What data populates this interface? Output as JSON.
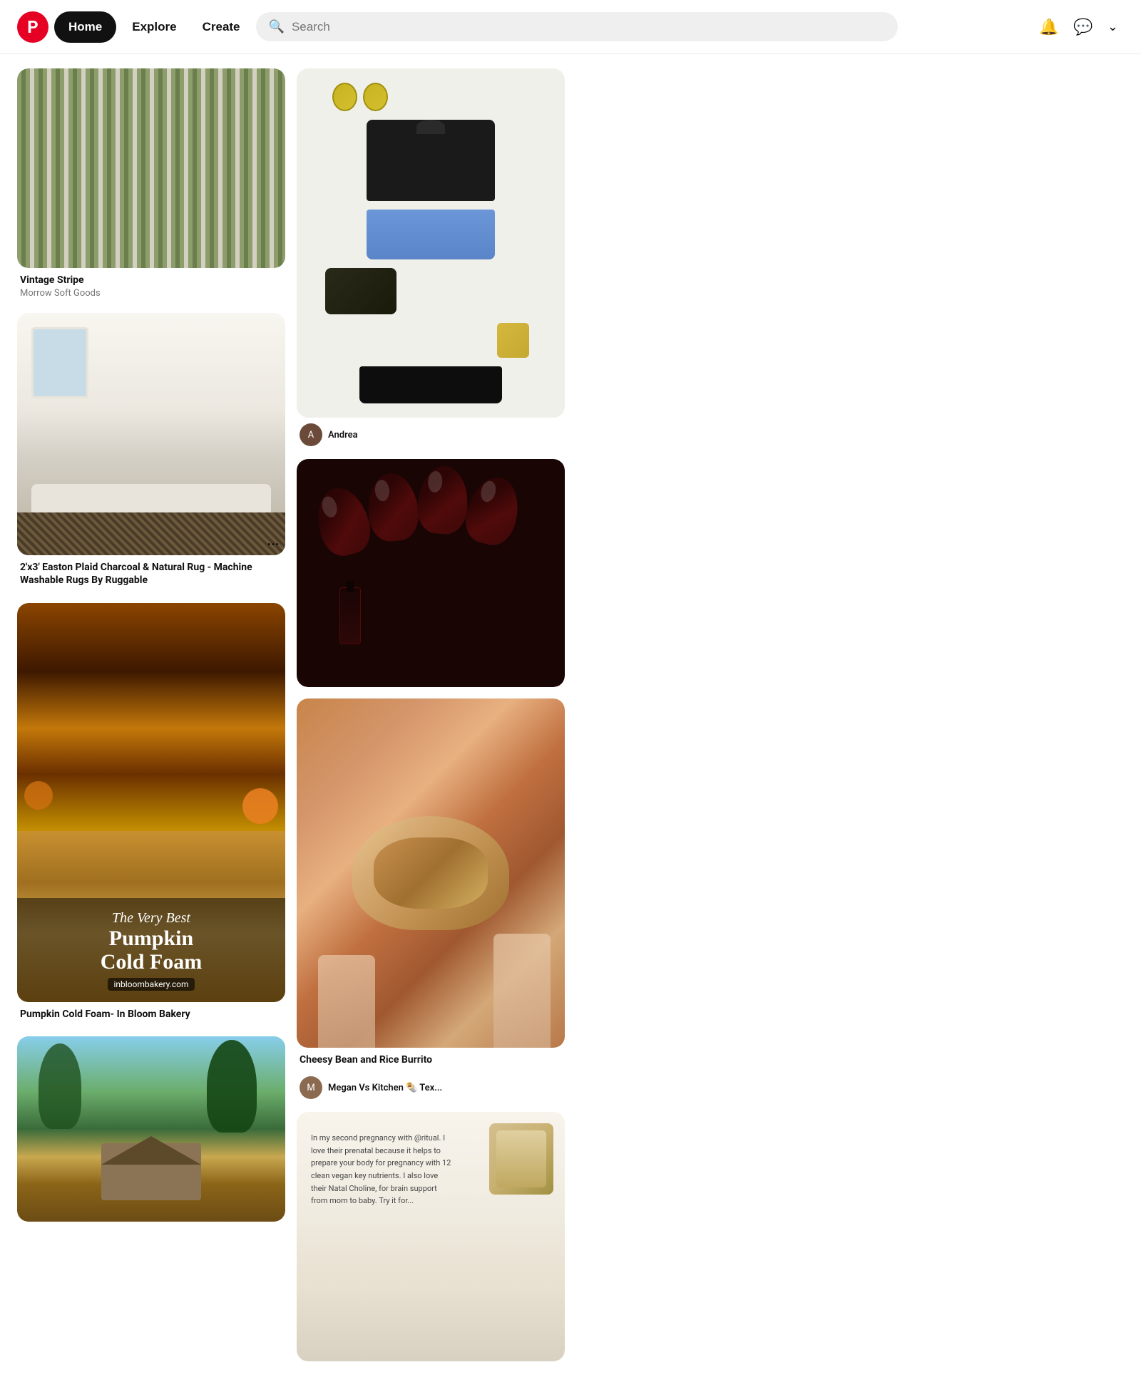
{
  "header": {
    "logo_text": "P",
    "nav_home": "Home",
    "nav_explore": "Explore",
    "nav_create": "Create",
    "search_placeholder": "Search"
  },
  "pins": [
    {
      "id": "pin-vintage-stripe",
      "type": "stripe",
      "title": "Vintage Stripe",
      "subtitle": "Morrow Soft Goods",
      "col": 0
    },
    {
      "id": "pin-pumpkin-cold-foam",
      "type": "pumpkin",
      "title": "Pumpkin Cold Foam- In Bloom Bakery",
      "subtitle": "",
      "overlay_cursive": "The Very Best",
      "overlay_bold1": "Pumpkin",
      "overlay_bold2": "Cold Foam",
      "overlay_site": "inbloombakery.com",
      "col": 1
    },
    {
      "id": "pin-andrea-fashion",
      "type": "fashion",
      "title": "",
      "subtitle": "",
      "author": "Andrea",
      "col": 2
    },
    {
      "id": "pin-burrito",
      "type": "burrito",
      "title": "Cheesy Bean and Rice Burrito",
      "subtitle": "Megan Vs Kitchen 🌯 Tex...",
      "has_author_avatar": true,
      "col": 3
    },
    {
      "id": "pin-rug",
      "type": "rug",
      "title": "2'x3' Easton Plaid Charcoal & Natural Rug - Machine Washable Rugs By Ruggable",
      "subtitle": "",
      "col": 0
    },
    {
      "id": "pin-house",
      "type": "house",
      "title": "",
      "subtitle": "",
      "col": 1
    },
    {
      "id": "pin-nails",
      "type": "nails",
      "title": "",
      "subtitle": "",
      "col": 2
    },
    {
      "id": "pin-supplement",
      "type": "supplement",
      "title": "",
      "subtitle": "",
      "col": 3
    }
  ],
  "icons": {
    "bell": "🔔",
    "message": "💬",
    "chevron": "˅",
    "search": "🔍",
    "more": "•••"
  }
}
